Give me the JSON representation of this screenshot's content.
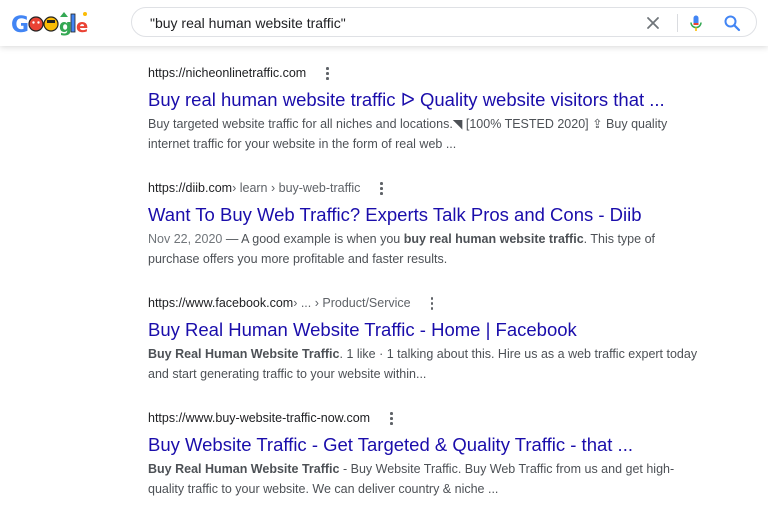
{
  "search": {
    "query": "\"buy real human website traffic\""
  },
  "logo": {
    "alt": "Google"
  },
  "icons": {
    "clear": "close-icon",
    "mic": "microphone-icon",
    "search": "search-icon",
    "more": "more-vert-icon"
  },
  "colors": {
    "link": "#1a0dab",
    "snippet": "#4d5156",
    "mic_blue": "#4285f4",
    "mic_red": "#ea4335"
  },
  "results": [
    {
      "url": "https://nicheonlinetraffic.com",
      "path": "",
      "title": "Buy real human website traffic ᐅ Quality website visitors that ...",
      "date": "",
      "snippet_1": "",
      "snippet_bold": "",
      "snippet_2": "Buy targeted website traffic for all niches and locations.◥ [100% TESTED 2020] ⇪ Buy quality internet traffic for your website in the form of real web ..."
    },
    {
      "url": "https://diib.com",
      "path": " › learn › buy-web-traffic",
      "title": "Want To Buy Web Traffic? Experts Talk Pros and Cons - Diib",
      "date": "Nov 22, 2020",
      "snippet_1": " — A good example is when you ",
      "snippet_bold": "buy real human website traffic",
      "snippet_2": ". This type of purchase offers you more profitable and faster results."
    },
    {
      "url": "https://www.facebook.com",
      "path": " › ... › Product/Service",
      "title": "Buy Real Human Website Traffic - Home | Facebook",
      "date": "",
      "snippet_1": "",
      "snippet_bold": "Buy Real Human Website Traffic",
      "snippet_2": ". 1 like · 1 talking about this. Hire us as a web traffic expert today and start generating traffic to your website within..."
    },
    {
      "url": "https://www.buy-website-traffic-now.com",
      "path": "",
      "title": "Buy Website Traffic - Get Targeted & Quality Traffic - that ...",
      "date": "",
      "snippet_1": "",
      "snippet_bold": "Buy Real Human Website Traffic",
      "snippet_2": " - Buy Website Traffic. Buy Web Traffic from us and get high-quality traffic to your website. We can deliver country & niche ..."
    }
  ]
}
